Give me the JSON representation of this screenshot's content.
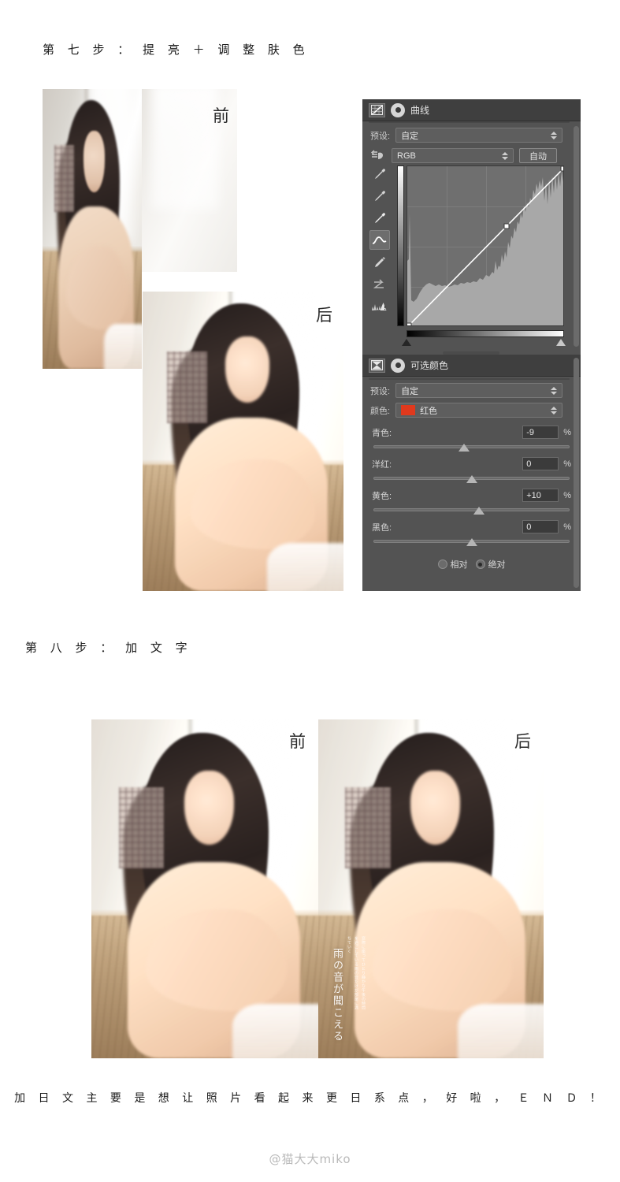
{
  "steps": {
    "step7_title": "第 七 步 ： 提 亮 ＋ 调 整 肤 色",
    "step8_title": "第 八 步 ： 加 文 字"
  },
  "footer": {
    "note": "加 日 文 主 要 是 想 让 照 片 看 起 来 更 日 系 点 ， 好 啦 ， Ｅ Ｎ Ｄ ！",
    "watermark": "@猫大大miko"
  },
  "labels": {
    "before": "前",
    "after": "后"
  },
  "photo_overlay": {
    "jp_headline": "雨の音が聞こえる",
    "jp_body": "窓際に座ってひとり静かな午後の時間を過ごしている雨の音だけが部屋に満ちていく"
  },
  "curves_panel": {
    "title": "曲线",
    "icon_adjustment": "curves-adjustment-icon",
    "icon_mask": "layer-mask-icon",
    "preset_label": "预设:",
    "preset_value": "自定",
    "channel_value": "RGB",
    "auto_button": "自动",
    "tools": [
      "on-image-adjust-icon",
      "sample-black-point-eyedropper-icon",
      "sample-gray-point-eyedropper-icon",
      "sample-white-point-eyedropper-icon",
      "curve-point-tool-icon",
      "pencil-draw-curve-icon",
      "smooth-curve-icon",
      "clipping-warning-icon"
    ],
    "curve_points": [
      {
        "x": 0,
        "y": 0
      },
      {
        "x": 0.62,
        "y": 0.62
      },
      {
        "x": 1.0,
        "y": 1.0
      }
    ],
    "black_point": 0,
    "white_point": 255
  },
  "selective_color_panel": {
    "title": "可选颜色",
    "icon_adjustment": "selective-color-adjustment-icon",
    "icon_mask": "layer-mask-icon",
    "preset_label": "预设:",
    "preset_value": "自定",
    "color_label": "颜色:",
    "color_value": "红色",
    "color_swatch": "#e0391d",
    "sliders": [
      {
        "name": "青色:",
        "value": "-9",
        "unit": "%",
        "pos": 41
      },
      {
        "name": "洋红:",
        "value": "0",
        "unit": "%",
        "pos": 50
      },
      {
        "name": "黄色:",
        "value": "+10",
        "unit": "%",
        "pos": 55
      },
      {
        "name": "黑色:",
        "value": "0",
        "unit": "%",
        "pos": 50
      }
    ],
    "method_relative": "相对",
    "method_absolute": "绝对",
    "method_selected": "绝对"
  },
  "colors": {
    "panel_bg": "#535353",
    "panel_header": "#3f3f3f",
    "text": "#d9d9d9",
    "accent_red": "#e0391d",
    "page_bg": "#ffffff"
  }
}
